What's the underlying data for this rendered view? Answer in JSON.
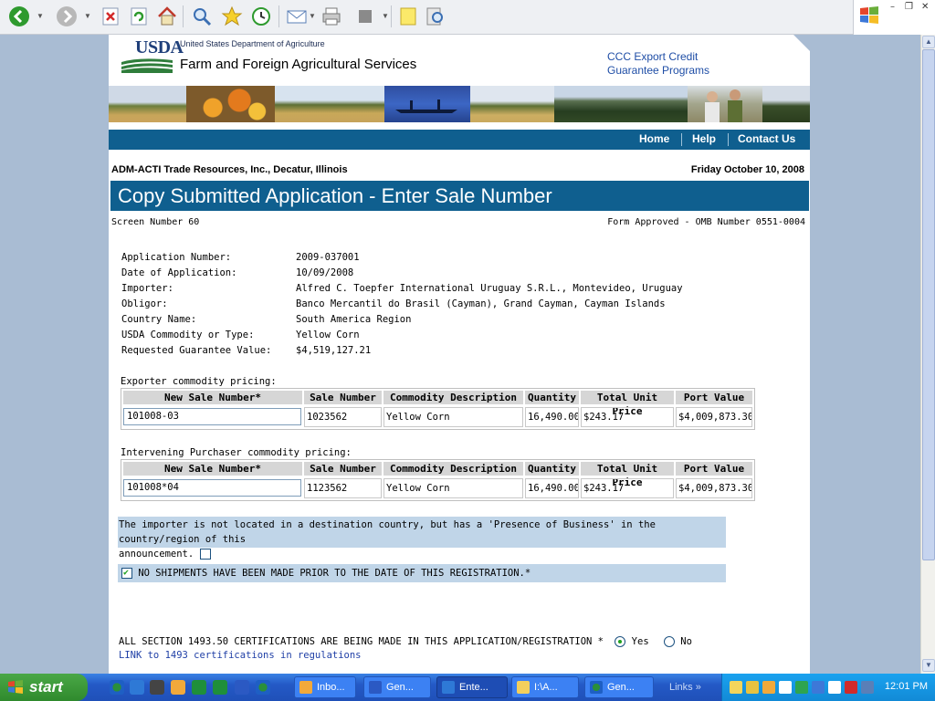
{
  "browser": {
    "back_label": "Back",
    "forward_label": "Forward",
    "toolbar_icons": [
      "back-icon",
      "forward-icon",
      "stop-icon",
      "refresh-icon",
      "home-icon",
      "search-icon",
      "favorites-icon",
      "history-icon",
      "mail-icon",
      "print-icon",
      "edit-icon",
      "note-icon",
      "research-icon"
    ]
  },
  "header": {
    "logo_text": "USDA",
    "department": "United States Department of Agriculture",
    "agency": "Farm and Foreign Agricultural Services",
    "program_line1": "CCC Export Credit",
    "program_line2": "Guarantee Programs"
  },
  "nav": {
    "items": [
      {
        "label": "Home"
      },
      {
        "label": "Help"
      },
      {
        "label": "Contact Us"
      }
    ]
  },
  "context": {
    "company": "ADM-ACTI Trade Resources, Inc., Decatur, Illinois",
    "date": "Friday October 10, 2008"
  },
  "page": {
    "title": "Copy Submitted Application - Enter Sale Number",
    "screen_number": "Screen Number 60",
    "form_approved": "Form Approved - OMB Number 0551-0004"
  },
  "application": {
    "rows": [
      {
        "label": "Application Number:",
        "value": "2009-037001"
      },
      {
        "label": "Date of Application:",
        "value": "10/09/2008"
      },
      {
        "label": "Importer:",
        "value": "Alfred C. Toepfer International Uruguay S.R.L., Montevideo, Uruguay"
      },
      {
        "label": "Obligor:",
        "value": "Banco Mercantil do Brasil (Cayman), Grand Cayman, Cayman Islands"
      },
      {
        "label": "Country Name:",
        "value": "South America Region"
      },
      {
        "label": "USDA Commodity or Type:",
        "value": "Yellow Corn"
      },
      {
        "label": "Requested Guarantee Value:",
        "value": "$4,519,127.21"
      }
    ]
  },
  "pricing_headers": [
    "New Sale Number*",
    "Sale Number",
    "Commodity Description",
    "Quantity",
    "Total Unit Price",
    "Port Value"
  ],
  "exporter": {
    "label": "Exporter commodity pricing:",
    "new_sale_number": "101008-03",
    "sale_number": "1023562",
    "commodity": "Yellow Corn",
    "quantity": "16,490.00",
    "unit_price": "$243.17",
    "port_value": "$4,009,873.30"
  },
  "intervening": {
    "label": "Intervening Purchaser commodity pricing:",
    "new_sale_number": "101008*04",
    "sale_number": "1123562",
    "commodity": "Yellow Corn",
    "quantity": "16,490.00",
    "unit_price": "$243.17",
    "port_value": "$4,009,873.30"
  },
  "presence_notice": {
    "line1": "The importer is not located in a destination country, but has a 'Presence of Business' in the country/region of this",
    "line2": "announcement.",
    "checked": false
  },
  "no_shipments": {
    "text": "NO SHIPMENTS HAVE BEEN MADE PRIOR TO THE DATE OF THIS REGISTRATION.*",
    "checked": true
  },
  "certification": {
    "text": "ALL SECTION 1493.50 CERTIFICATIONS ARE BEING MADE IN THIS APPLICATION/REGISTRATION *",
    "yes_label": "Yes",
    "no_label": "No",
    "selected": "Yes",
    "link": "LINK to 1493 certifications in regulations"
  },
  "taskbar": {
    "start_label": "start",
    "tasks": [
      {
        "label": "Inbo...",
        "icon": "outlook-icon"
      },
      {
        "label": "Gen...",
        "icon": "word-icon"
      },
      {
        "label": "Ente...",
        "icon": "ie-icon",
        "active": true
      },
      {
        "label": "I:\\A...",
        "icon": "folder-icon"
      },
      {
        "label": "Gen...",
        "icon": "ie-icon"
      }
    ],
    "links_label": "Links",
    "links_chevron": "»",
    "clock": "12:01 PM"
  },
  "colors": {
    "accent_blue": "#0f5f8f",
    "notice_bg": "#c0d5e8",
    "link_blue": "#1f4ea6"
  }
}
